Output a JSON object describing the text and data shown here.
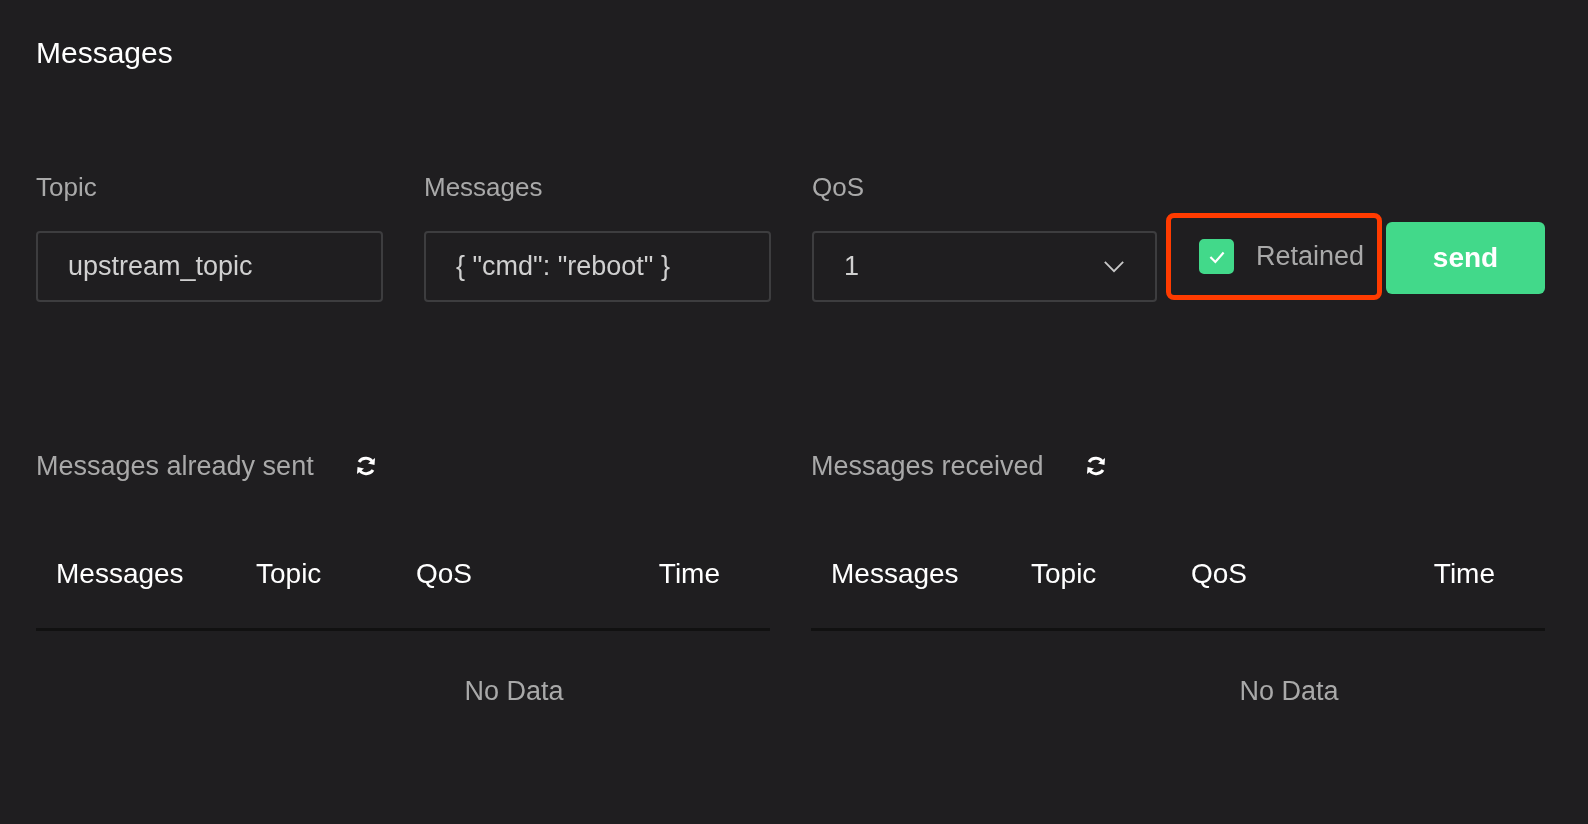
{
  "title": "Messages",
  "form": {
    "topic": {
      "label": "Topic",
      "value": "upstream_topic"
    },
    "message": {
      "label": "Messages",
      "value": "{ \"cmd\": \"reboot\" }"
    },
    "qos": {
      "label": "QoS",
      "value": "1"
    },
    "retained": {
      "label": "Retained",
      "checked": true,
      "highlighted": true
    },
    "send_button": "send"
  },
  "panels": [
    {
      "title": "Messages already sent",
      "columns": [
        "Messages",
        "Topic",
        "QoS",
        "Time"
      ],
      "empty_text": "No Data"
    },
    {
      "title": "Messages received",
      "columns": [
        "Messages",
        "Topic",
        "QoS",
        "Time"
      ],
      "empty_text": "No Data"
    }
  ]
}
